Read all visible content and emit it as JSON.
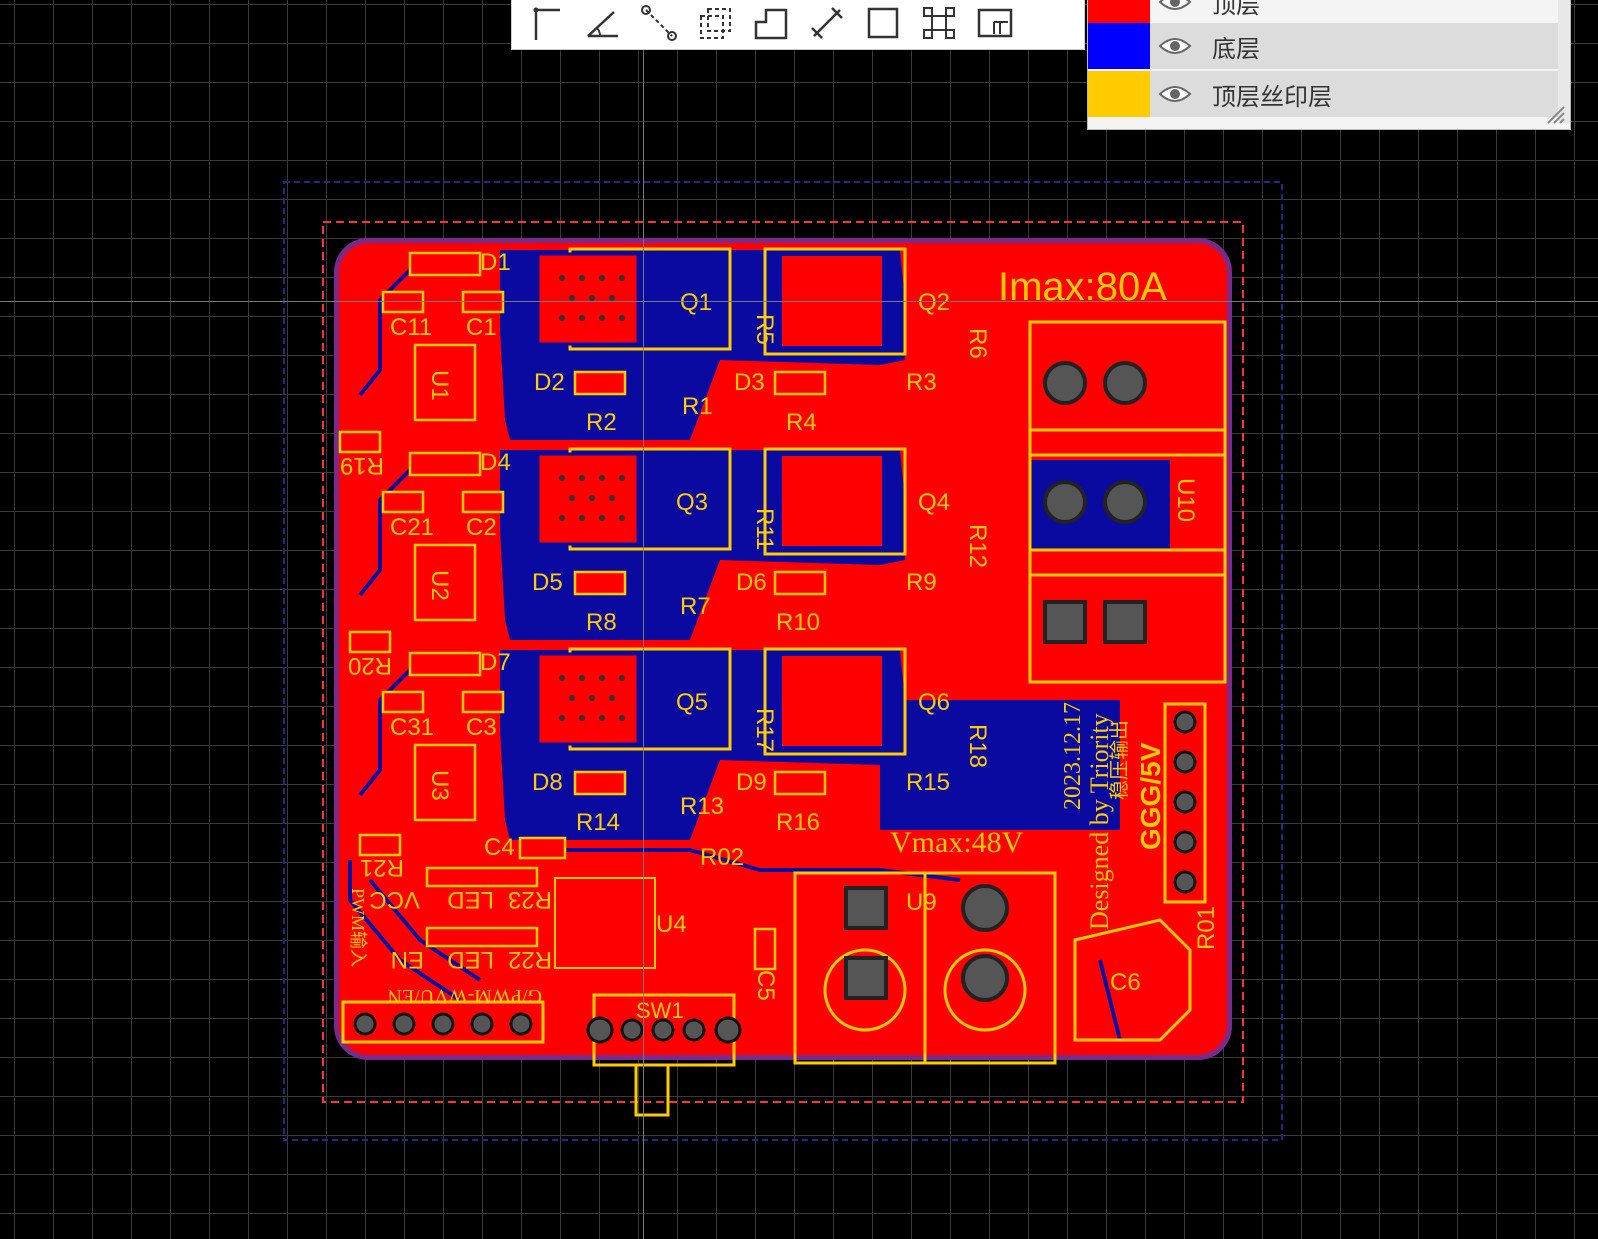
{
  "colors": {
    "canvas_bg": "#000000",
    "grid": "#3a3a3a",
    "top_copper": "#ff0000",
    "bottom_copper": "#0000aa",
    "silkscreen": "#ffcc00",
    "board_outline": "#7a2a8a",
    "keepout": "#ff3333"
  },
  "toolbar": {
    "tools": [
      "polyline-tool-icon",
      "angle-tool-icon",
      "node-tool-icon",
      "dashed-rect-tool-icon",
      "step-tool-icon",
      "dimension-tool-icon",
      "rectangle-tool-icon",
      "align-tool-icon",
      "copper-area-tool-icon"
    ]
  },
  "layers": [
    {
      "name": "顶层",
      "color": "#ff0000"
    },
    {
      "name": "底层",
      "color": "#0000ff"
    },
    {
      "name": "顶层丝印层",
      "color": "#ffcc00"
    }
  ],
  "board": {
    "title": "Imax:80A",
    "vmax": "Vmax:48V",
    "designer": "Designed by Triority",
    "date": "2023.12.17",
    "regulated": "稳压输出",
    "gnd_5v": "GGG/5V",
    "pwm_input": "PWM输入",
    "pwm_pins": "G/PWM-WVU/EN",
    "vcc_label": "VCC",
    "en_label": "EN",
    "led_label_1": "LED",
    "led_label_2": "LED",
    "refs": {
      "D1": "D1",
      "D2": "D2",
      "D3": "D3",
      "D4": "D4",
      "D5": "D5",
      "D6": "D6",
      "D7": "D7",
      "D8": "D8",
      "D9": "D9",
      "C1": "C1",
      "C2": "C2",
      "C3": "C3",
      "C4": "C4",
      "C5": "C5",
      "C6": "C6",
      "C11": "C11",
      "C21": "C21",
      "C31": "C31",
      "Q1": "Q1",
      "Q2": "Q2",
      "Q3": "Q3",
      "Q4": "Q4",
      "Q5": "Q5",
      "Q6": "Q6",
      "U1": "U1",
      "U2": "U2",
      "U3": "U3",
      "U4": "U4",
      "U9": "U9",
      "U10": "U10",
      "R1": "R1",
      "R2": "R2",
      "R3": "R3",
      "R4": "R4",
      "R5": "R5",
      "R6": "R6",
      "R7": "R7",
      "R8": "R8",
      "R9": "R9",
      "R10": "R10",
      "R11": "R11",
      "R12": "R12",
      "R13": "R13",
      "R14": "R14",
      "R15": "R15",
      "R16": "R16",
      "R17": "R17",
      "R18": "R18",
      "R19": "R19",
      "R20": "R20",
      "R21": "R21",
      "R22": "R22",
      "R23": "R23",
      "R01": "R01",
      "R02": "R02",
      "SW1": "SW1"
    }
  }
}
